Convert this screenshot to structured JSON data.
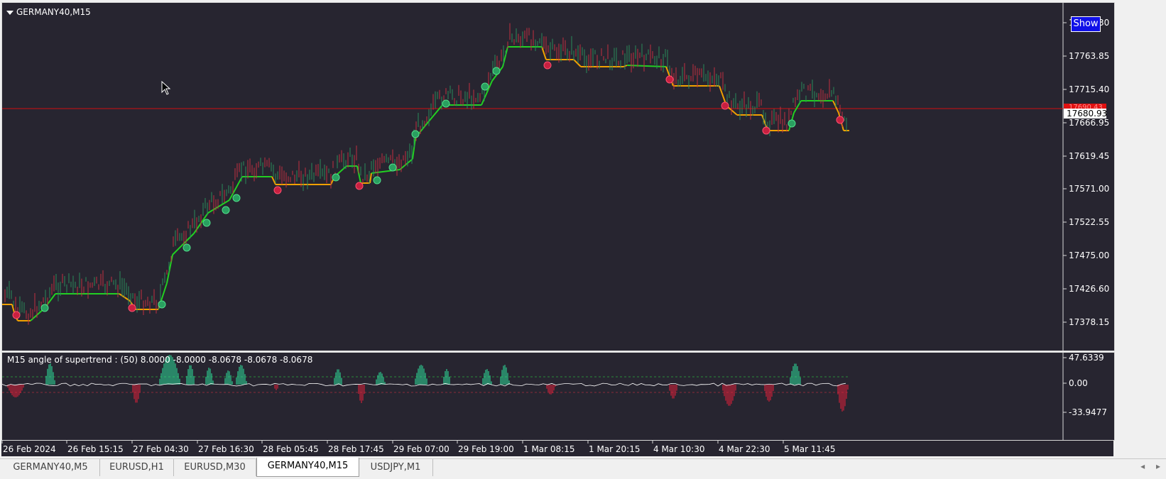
{
  "chart": {
    "title": "GERMANY40,M15",
    "show_button": "Show",
    "price_labels": [
      "17812.30",
      "17763.85",
      "17715.40",
      "17666.95",
      "17619.45",
      "17571.00",
      "17522.55",
      "17475.00",
      "17426.60",
      "17378.15"
    ],
    "current_price": "17680.93",
    "bid_marker": "17690.43",
    "colors": {
      "background": "#272530",
      "up_line": "#22d022",
      "down_line": "#f0a000",
      "bid_line": "#d01010",
      "candle_up": "#2a8a5a",
      "candle_down": "#c03040"
    }
  },
  "indicator": {
    "title": "M15  angle of supertrend :  (50)  8.0000 -8.0000 -8.0678 -8.0678 -8.0678",
    "scale_labels": [
      "47.6339",
      "0.00",
      "-33.9477"
    ],
    "colors": {
      "positive": "#2ee8a0",
      "negative": "#e8203a",
      "line": "#ffffff"
    }
  },
  "time_axis": {
    "labels": [
      "26 Feb 2024",
      "26 Feb 15:15",
      "27 Feb 04:30",
      "27 Feb 16:30",
      "28 Feb 05:45",
      "28 Feb 17:45",
      "29 Feb 07:00",
      "29 Feb 19:00",
      "1 Mar 08:15",
      "1 Mar 20:15",
      "4 Mar 10:30",
      "4 Mar 22:30",
      "5 Mar 11:45"
    ]
  },
  "tabs": [
    {
      "label": "GERMANY40,M5",
      "active": false
    },
    {
      "label": "EURUSD,H1",
      "active": false
    },
    {
      "label": "EURUSD,M30",
      "active": false
    },
    {
      "label": "GERMANY40,M15",
      "active": true
    },
    {
      "label": "USDJPY,M1",
      "active": false
    }
  ]
}
